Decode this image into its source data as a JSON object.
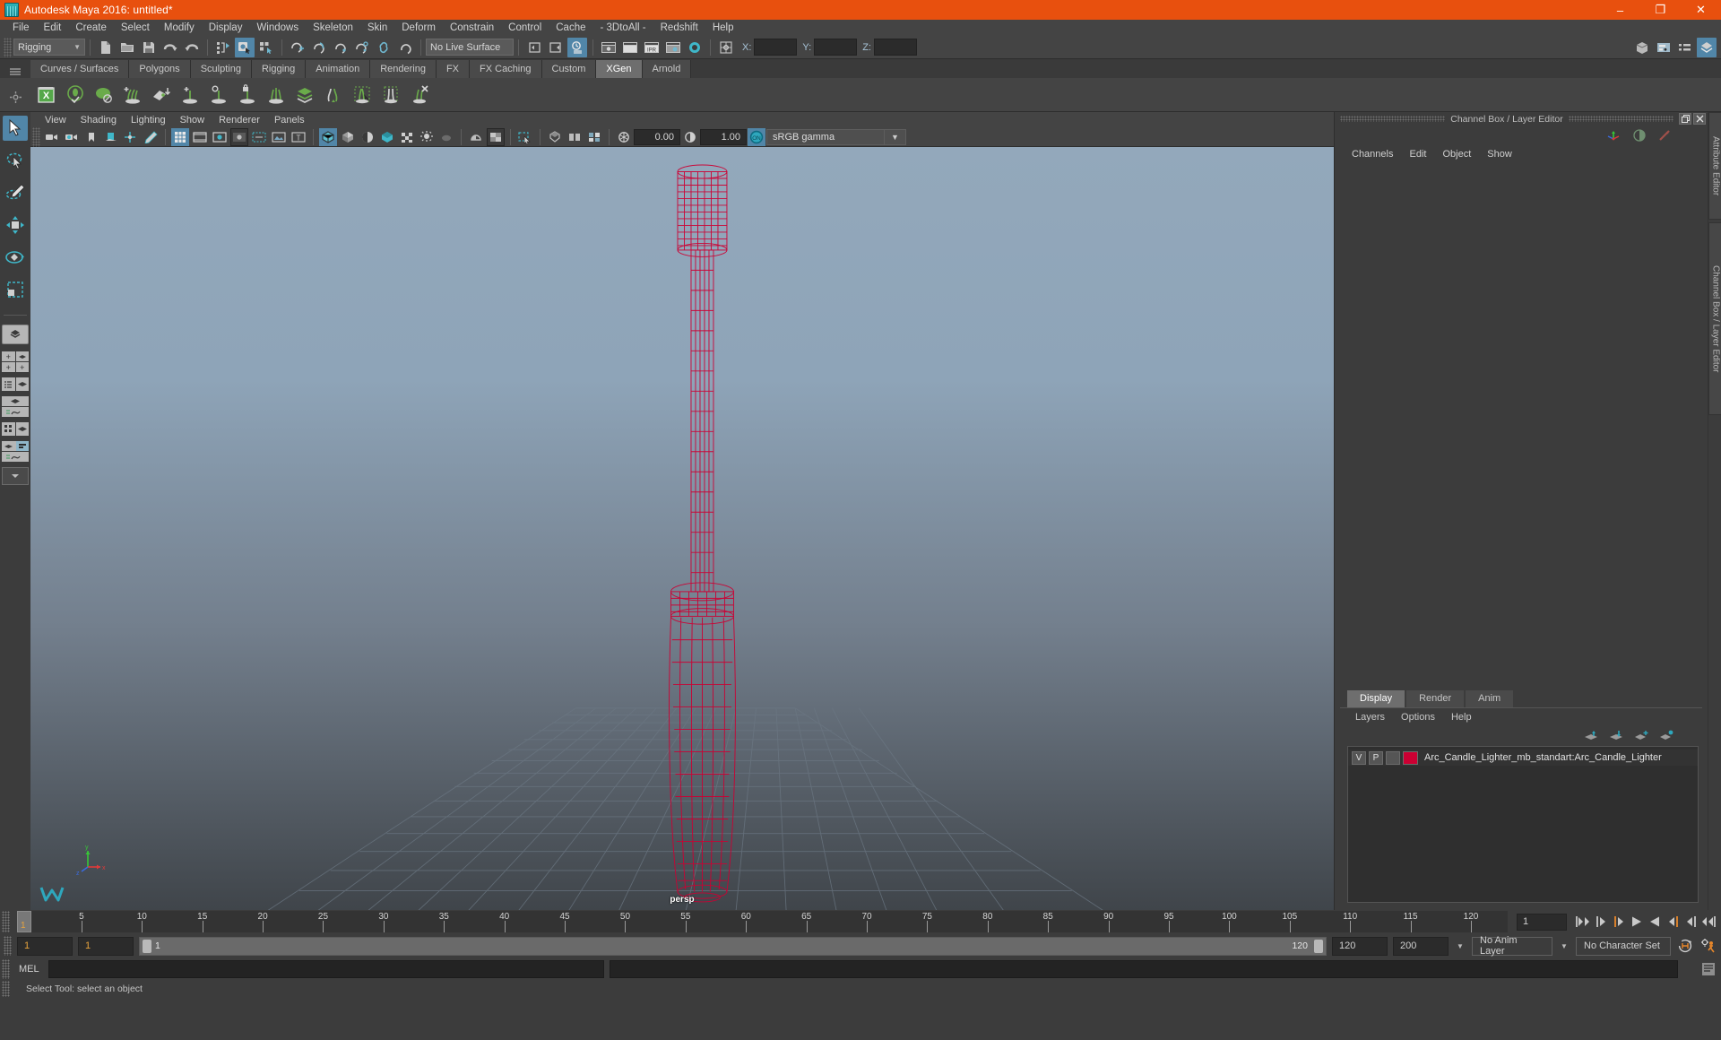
{
  "window": {
    "title": "Autodesk Maya 2016: untitled*",
    "logo_icon": "maya-logo-icon",
    "minimize_label": "–",
    "maximize_label": "❐",
    "close_label": "✕"
  },
  "menubar": {
    "items": [
      "File",
      "Edit",
      "Create",
      "Select",
      "Modify",
      "Display",
      "Windows",
      "Skeleton",
      "Skin",
      "Deform",
      "Constrain",
      "Control",
      "Cache",
      "- 3DtoAll -",
      "Redshift",
      "Help"
    ]
  },
  "statusline": {
    "menuset": "Rigging",
    "live_surface": "No Live Surface",
    "x_label": "X:",
    "y_label": "Y:",
    "z_label": "Z:",
    "x_value": "",
    "y_value": "",
    "z_value": "",
    "icons": [
      "new-scene-icon",
      "open-scene-icon",
      "save-scene-icon",
      "undo-icon",
      "redo-icon",
      "select-by-hierarchy-icon",
      "select-by-object-icon",
      "select-by-component-icon",
      "snap-to-grid-icon",
      "snap-to-curve-icon",
      "snap-to-point-icon",
      "snap-to-projected-center-icon",
      "snap-to-view-plane-icon",
      "make-live-icon",
      "show-hide-editors-icon",
      "show-hide-editor2-icon",
      "construction-history-icon",
      "render-current-frame-icon",
      "ipr-render-icon",
      "render-settings-icon",
      "hypershade-icon",
      "render-view-icon",
      "transform-manipulator-icon",
      "sidebar-attribute-icon",
      "sidebar-tool-icon",
      "sidebar-channel-icon",
      "sidebar-layer-icon"
    ]
  },
  "shelf": {
    "tabs": [
      "Curves / Surfaces",
      "Polygons",
      "Sculpting",
      "Rigging",
      "Animation",
      "Rendering",
      "FX",
      "FX Caching",
      "Custom",
      "XGen",
      "Arnold"
    ],
    "active_tab": "XGen",
    "buttons": [
      "xgen-editor-icon",
      "xgen-preview-icon",
      "xgen-geometry-icon",
      "xgen-add-groom-icon",
      "xgen-export-icon",
      "xgen-add-guide-icon",
      "xgen-guide-region-icon",
      "xgen-lock-guide-icon",
      "xgen-comb-icon",
      "xgen-layers-icon",
      "xgen-noise-icon",
      "xgen-clump-icon",
      "xgen-cut-icon",
      "xgen-delete-icon"
    ]
  },
  "toolbox": {
    "tools": [
      "select-tool-icon",
      "lasso-select-tool-icon",
      "paint-select-tool-icon",
      "move-tool-icon",
      "rotate-tool-icon",
      "scale-tool-icon",
      "last-tool-icon"
    ],
    "active_tool": "select-tool-icon",
    "layouts": [
      "single-perspective-view-icon",
      "four-view-layout-icon",
      "persp-outliner-layout-icon",
      "persp-graph-layout-icon",
      "hypershade-persp-layout-icon",
      "persp-graph-outliner-layout-icon",
      "more-layouts-icon"
    ]
  },
  "viewport": {
    "panel_menus": [
      "View",
      "Shading",
      "Lighting",
      "Show",
      "Renderer",
      "Panels"
    ],
    "exposure_value": "0.00",
    "gamma_value": "1.00",
    "color_profile": "sRGB gamma",
    "camera_label": "persp",
    "toolbar_icons": [
      "select-camera-icon",
      "camera-attributes-icon",
      "bookmark-icon",
      "image-plane-icon",
      "two-d-pan-zoom-icon",
      "grease-pencil-icon",
      "grid-toggle-icon",
      "film-gate-icon",
      "resolution-gate-icon",
      "gate-mask-icon",
      "field-chart-icon",
      "safe-action-icon",
      "safe-title-icon",
      "wireframe-shading-icon",
      "smooth-shade-all-icon",
      "smooth-shade-selected-icon",
      "flat-shade-icon",
      "wireframe-on-shaded-icon",
      "lighting-toggle-icon",
      "shadows-icon",
      "screen-space-ao-icon",
      "motion-blur-icon",
      "multisample-icon",
      "isolate-select-icon",
      "xray-icon",
      "xray-joints-icon",
      "xray-active-components-icon",
      "exposure-icon",
      "gamma-icon",
      "color-management-toggle-icon"
    ]
  },
  "right_panel": {
    "title": "Channel Box / Layer Editor",
    "restore_icon": "restore-panel-icon",
    "close_icon": "close-panel-icon",
    "header_icons": [
      "manipulator-icon",
      "channel-box-toggle-icon",
      "attribute-editor-toggle-icon"
    ],
    "channelbox_menus": [
      "Channels",
      "Edit",
      "Object",
      "Show"
    ],
    "rail_tabs": [
      "Attribute Editor",
      "Channel Box / Layer Editor"
    ]
  },
  "layer_editor": {
    "tabs": [
      "Display",
      "Render",
      "Anim"
    ],
    "active_tab": "Display",
    "menus": [
      "Layers",
      "Options",
      "Help"
    ],
    "toolbar_icons": [
      "move-layer-up-icon",
      "move-layer-down-icon",
      "new-layer-icon",
      "new-layer-from-selected-icon"
    ],
    "layers": [
      {
        "visibility": "V",
        "playback": "P",
        "type": "",
        "color": "#cc0033",
        "name": "Arc_Candle_Lighter_mb_standart:Arc_Candle_Lighter"
      }
    ]
  },
  "timeline": {
    "ticks": [
      5,
      10,
      15,
      20,
      25,
      30,
      35,
      40,
      45,
      50,
      55,
      60,
      65,
      70,
      75,
      80,
      85,
      90,
      95,
      100,
      105,
      110,
      115,
      120
    ],
    "current_frame": "1",
    "current_frame_field": "1",
    "playback_icons": [
      "go-to-start-icon",
      "step-back-frame-icon",
      "step-back-key-icon",
      "play-backwards-icon",
      "play-forwards-icon",
      "step-forward-key-icon",
      "step-forward-frame-icon",
      "go-to-end-icon"
    ]
  },
  "range": {
    "anim_start": "1",
    "range_start": "1",
    "range_slider_start": "1",
    "range_slider_end": "120",
    "range_end": "120",
    "anim_end": "200",
    "anim_layer": "No Anim Layer",
    "character_set": "No Character Set",
    "auto_key_icon": "auto-keyframe-icon",
    "prefs_icon": "animation-preferences-icon"
  },
  "command_line": {
    "language_label": "MEL",
    "input_value": "",
    "output_value": "",
    "script_editor_icon": "script-editor-icon"
  },
  "help_line": {
    "text": "Select Tool: select an object"
  },
  "colors": {
    "title_bar": "#e8500e",
    "accent_selected": "#5186a8",
    "layer_color": "#cc0033",
    "orange_text": "#e8a33d",
    "xgen_green": "#6aab4a"
  }
}
